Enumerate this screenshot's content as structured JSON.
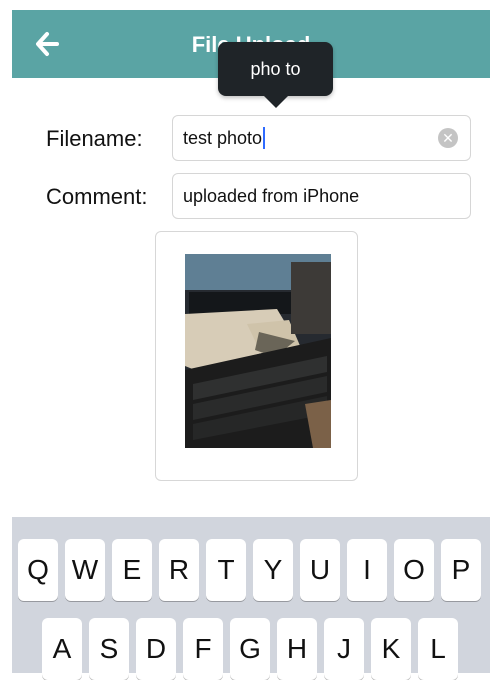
{
  "header": {
    "title": "File Upload",
    "back_icon": "arrow-left-icon",
    "color": "#5aa4a4"
  },
  "tooltip": {
    "suggestion": "pho to"
  },
  "form": {
    "filename_label": "Filename:",
    "filename_value": "test photo",
    "comment_label": "Comment:",
    "comment_value": "uploaded from iPhone",
    "clear_icon": "clear-circle-icon"
  },
  "preview": {
    "alt": "Uploaded photo preview"
  },
  "keyboard": {
    "row1": [
      "Q",
      "W",
      "E",
      "R",
      "T",
      "Y",
      "U",
      "I",
      "O",
      "P"
    ],
    "row2": [
      "A",
      "S",
      "D",
      "F",
      "G",
      "H",
      "J",
      "K",
      "L"
    ]
  }
}
